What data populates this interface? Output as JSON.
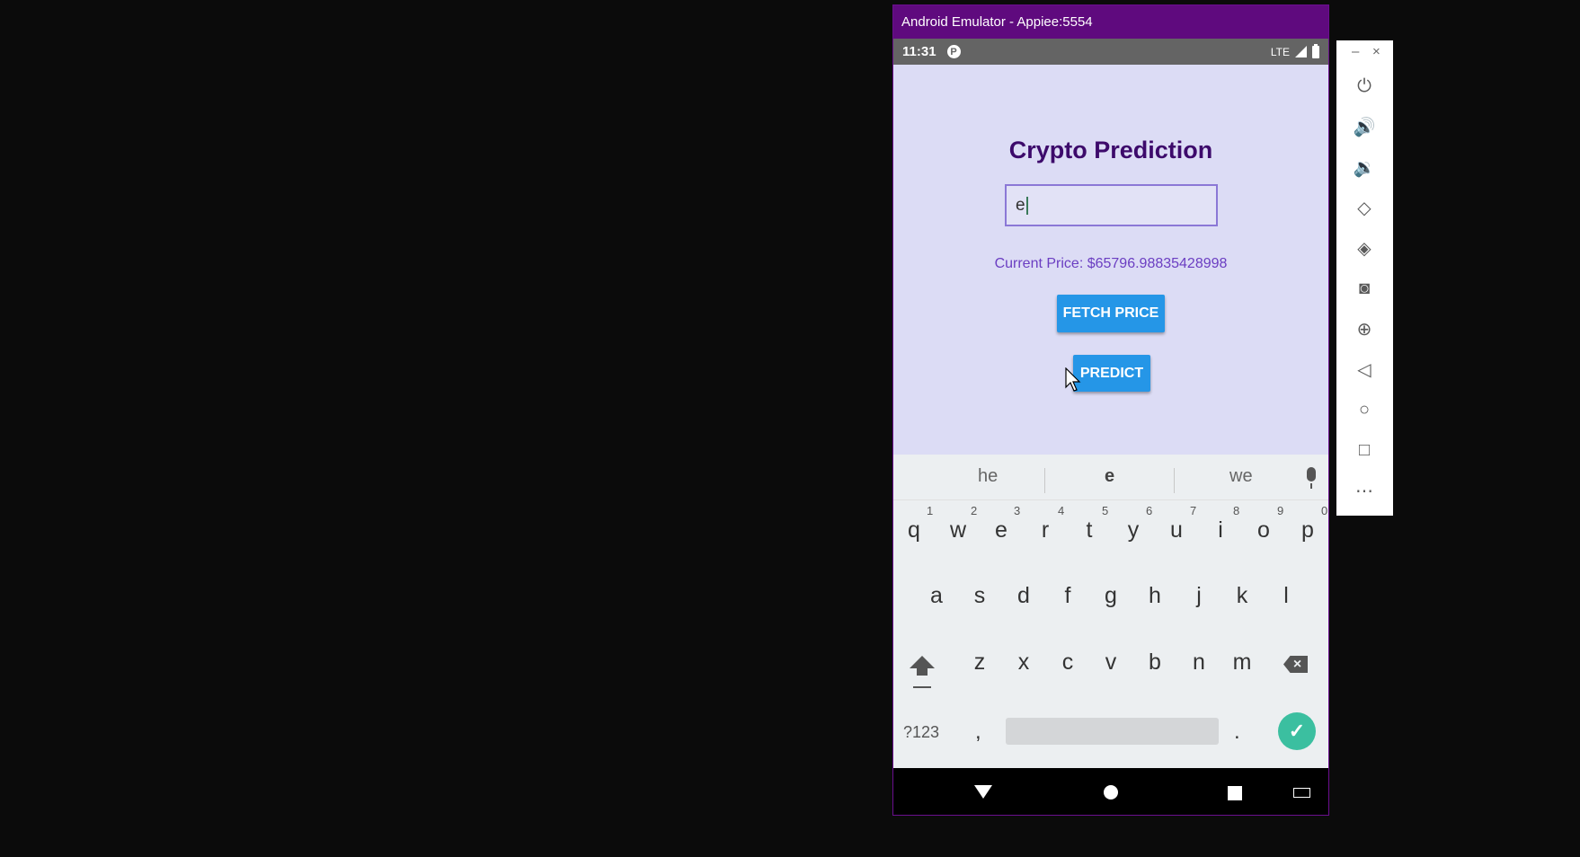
{
  "window": {
    "title": "Android Emulator - Appiee:5554"
  },
  "status_bar": {
    "time": "11:31",
    "network": "LTE"
  },
  "app": {
    "title": "Crypto Prediction",
    "input_value": "e",
    "price_text": "Current Price: $65796.98835428998",
    "fetch_button": "FETCH PRICE",
    "predict_button": "PREDICT"
  },
  "keyboard": {
    "suggestions": [
      "he",
      "e",
      "we"
    ],
    "row1": [
      "q",
      "w",
      "e",
      "r",
      "t",
      "y",
      "u",
      "i",
      "o",
      "p"
    ],
    "row1_numbers": [
      "1",
      "2",
      "3",
      "4",
      "5",
      "6",
      "7",
      "8",
      "9",
      "0"
    ],
    "row2": [
      "a",
      "s",
      "d",
      "f",
      "g",
      "h",
      "j",
      "k",
      "l"
    ],
    "row3": [
      "z",
      "x",
      "c",
      "v",
      "b",
      "n",
      "m"
    ],
    "symbols_label": "?123",
    "comma": ",",
    "period": "."
  },
  "toolbar": {
    "items": [
      "power",
      "volume-up",
      "volume-down",
      "rotate-left",
      "rotate-right",
      "screenshot",
      "zoom",
      "back",
      "home",
      "overview",
      "more"
    ],
    "minimize": "–",
    "close": "×"
  },
  "colors": {
    "titlebar": "#5f0a7e",
    "app_background": "#dcdcf5",
    "title_color": "#3d0a6b",
    "price_color": "#6b3ec2",
    "button": "#2596e7",
    "enter": "#3bbfa0"
  }
}
